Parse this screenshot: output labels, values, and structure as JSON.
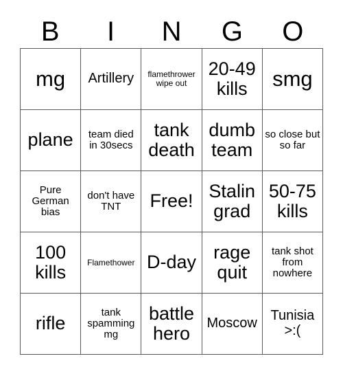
{
  "card": {
    "title": "BINGO",
    "headers": [
      "B",
      "I",
      "N",
      "G",
      "O"
    ],
    "colors": {
      "background": "#ffffff",
      "text": "#000000",
      "grid_line": "#5a5a5a"
    },
    "rows": [
      [
        {
          "text": "mg",
          "size": "s-xl"
        },
        {
          "text": "Artillery",
          "size": "s-md"
        },
        {
          "text": "flamethrower wipe out",
          "size": "s-xs"
        },
        {
          "text": "20-49 kills",
          "size": "s-lg"
        },
        {
          "text": "smg",
          "size": "s-xl"
        }
      ],
      [
        {
          "text": "plane",
          "size": "s-lg"
        },
        {
          "text": "team died in 30secs",
          "size": "s-sm"
        },
        {
          "text": "tank death",
          "size": "s-lg"
        },
        {
          "text": "dumb team",
          "size": "s-lg"
        },
        {
          "text": "so close but so far",
          "size": "s-sm"
        }
      ],
      [
        {
          "text": "Pure German bias",
          "size": "s-sm"
        },
        {
          "text": "don't have TNT",
          "size": "s-sm"
        },
        {
          "text": "Free!",
          "size": "s-lg"
        },
        {
          "text": "Stalin grad",
          "size": "s-lg"
        },
        {
          "text": "50-75 kills",
          "size": "s-lg"
        }
      ],
      [
        {
          "text": "100 kills",
          "size": "s-lg"
        },
        {
          "text": "Flamethower",
          "size": "s-xs"
        },
        {
          "text": "D-day",
          "size": "s-lg"
        },
        {
          "text": "rage quit",
          "size": "s-lg"
        },
        {
          "text": "tank shot from nowhere",
          "size": "s-sm"
        }
      ],
      [
        {
          "text": "rifle",
          "size": "s-lg"
        },
        {
          "text": "tank spamming mg",
          "size": "s-sm"
        },
        {
          "text": "battle hero",
          "size": "s-lg"
        },
        {
          "text": "Moscow",
          "size": "s-md"
        },
        {
          "text": "Tunisia >:(",
          "size": "s-md"
        }
      ]
    ]
  }
}
